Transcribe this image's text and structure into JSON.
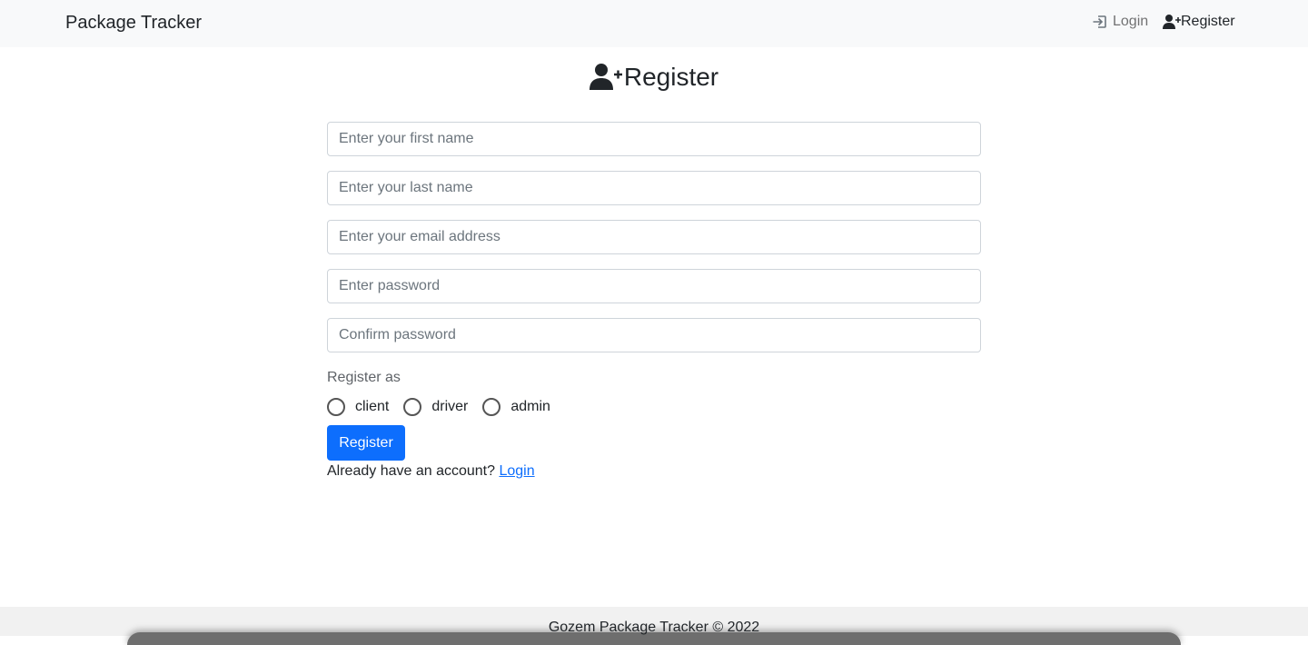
{
  "navbar": {
    "brand": "Package Tracker",
    "login_label": "Login",
    "register_label": "Register",
    "login_icon": "login-arrow-icon",
    "register_icon": "user-plus-icon"
  },
  "page": {
    "title": "Register",
    "title_icon": "user-plus-icon"
  },
  "form": {
    "first_name_placeholder": "Enter your first name",
    "last_name_placeholder": "Enter your last name",
    "email_placeholder": "Enter your email address",
    "password_placeholder": "Enter password",
    "confirm_password_placeholder": "Confirm password",
    "register_as_label": "Register as",
    "roles": [
      "client",
      "driver",
      "admin"
    ],
    "submit_label": "Register",
    "account_prompt": "Already have an account?",
    "login_link": "Login"
  },
  "footer": {
    "text": "Gozem Package Tracker © 2022"
  },
  "colors": {
    "navbar_bg": "#f8f9fa",
    "primary": "#0d6efd",
    "text": "#212529",
    "muted": "#6c757d",
    "footer_bg": "#f1f1f1"
  }
}
